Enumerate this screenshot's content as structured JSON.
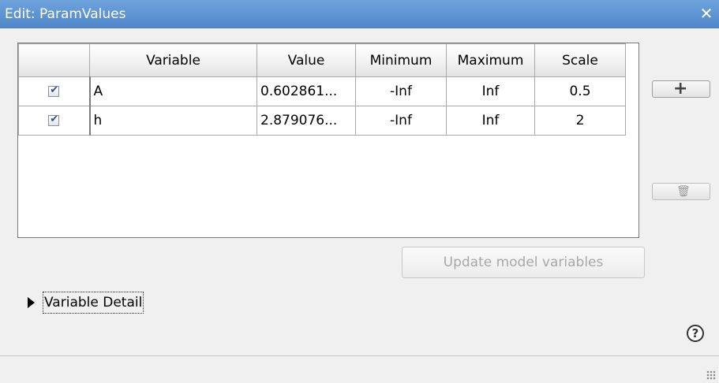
{
  "window": {
    "title": "Edit: ParamValues",
    "close_glyph": "✕"
  },
  "table": {
    "columns": [
      "",
      "Variable",
      "Value",
      "Minimum",
      "Maximum",
      "Scale"
    ],
    "rows": [
      {
        "checked": true,
        "variable": "A",
        "value": "0.602861...",
        "minimum": "-Inf",
        "maximum": "Inf",
        "scale": "0.5"
      },
      {
        "checked": true,
        "variable": "h",
        "value": "2.879076...",
        "minimum": "-Inf",
        "maximum": "Inf",
        "scale": "2"
      }
    ]
  },
  "buttons": {
    "add_icon": "plus-icon",
    "delete_icon": "trash-icon",
    "update_label": "Update model variables",
    "update_enabled": false
  },
  "detail": {
    "label": "Variable Detail",
    "expanded": false
  },
  "help": {
    "glyph": "?"
  },
  "colors": {
    "titlebar": "#5a92d4",
    "checkmark": "#2b4e8f",
    "disabled_text": "#a8a8a8"
  }
}
